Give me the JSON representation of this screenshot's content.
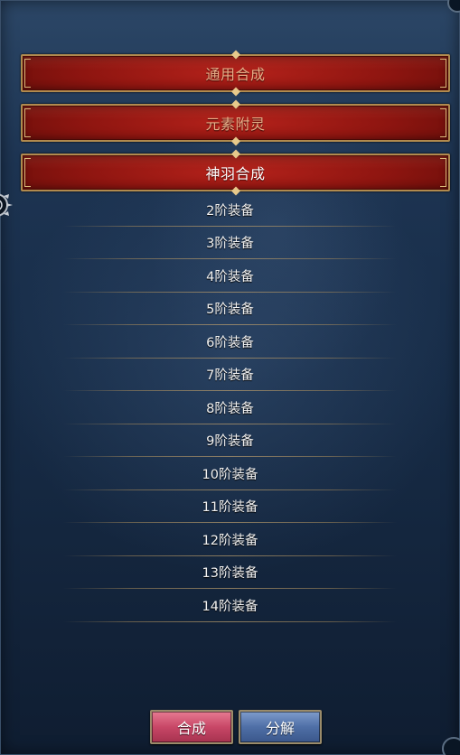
{
  "categories": [
    {
      "label": "通用合成",
      "active": false
    },
    {
      "label": "元素附灵",
      "active": false
    },
    {
      "label": "神羽合成",
      "active": true
    }
  ],
  "items": [
    {
      "label": "2阶装备"
    },
    {
      "label": "3阶装备"
    },
    {
      "label": "4阶装备"
    },
    {
      "label": "5阶装备"
    },
    {
      "label": "6阶装备"
    },
    {
      "label": "7阶装备"
    },
    {
      "label": "8阶装备"
    },
    {
      "label": "9阶装备"
    },
    {
      "label": "10阶装备"
    },
    {
      "label": "11阶装备"
    },
    {
      "label": "12阶装备"
    },
    {
      "label": "13阶装备"
    },
    {
      "label": "14阶装备"
    }
  ],
  "actions": {
    "compose_label": "合成",
    "decompose_label": "分解"
  },
  "colors": {
    "category_bg": "#8e1510",
    "category_border": "#b08a4e",
    "inactive_label": "#e8b089",
    "active_label": "#ffffff",
    "compose_button": "#c84767",
    "decompose_button": "#4f6fa6"
  }
}
